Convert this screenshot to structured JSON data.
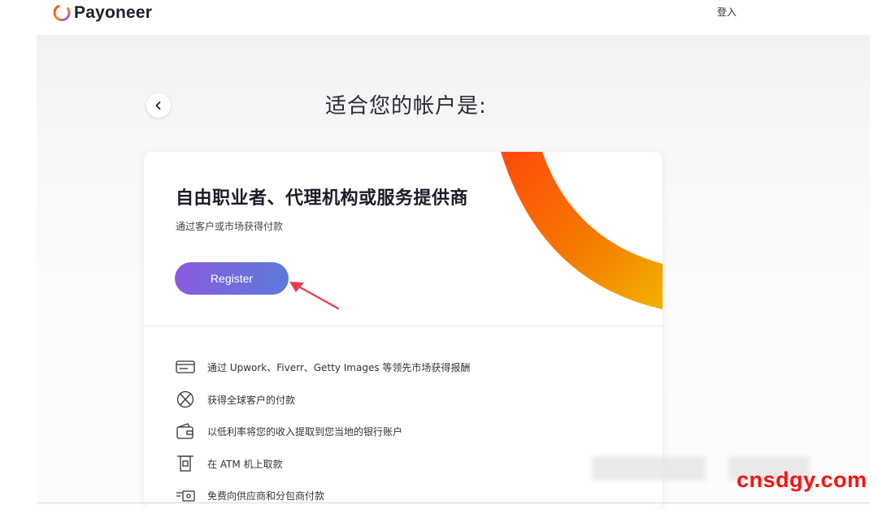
{
  "header": {
    "brand": "Payoneer",
    "login_label": "登入"
  },
  "page": {
    "title": "适合您的帐户是:"
  },
  "card": {
    "heading": "自由职业者、代理机构或服务提供商",
    "subtitle": "通过客户或市场获得付款",
    "register_label": "Register",
    "features": [
      {
        "icon": "card-icon",
        "text": "通过 Upwork、Fiverr、Getty Images 等领先市场获得报酬"
      },
      {
        "icon": "globe-icon",
        "text": "获得全球客户的付款"
      },
      {
        "icon": "wallet-icon",
        "text": "以低利率将您的收入提取到您当地的银行账户"
      },
      {
        "icon": "atm-icon",
        "text": "在 ATM 机上取款"
      },
      {
        "icon": "transfer-icon",
        "text": "免费向供应商和分包商付款"
      }
    ]
  },
  "watermark": "cnsdgy.com",
  "colors": {
    "brand_ring": "#ff6a1a",
    "register_gradient_start": "#8a5bde",
    "register_gradient_end": "#5d78da",
    "decor_orange": "#ff5a0a",
    "decor_yellow": "#f0b000",
    "arrow_red": "#ec3a52",
    "watermark_red": "#ff1010"
  }
}
